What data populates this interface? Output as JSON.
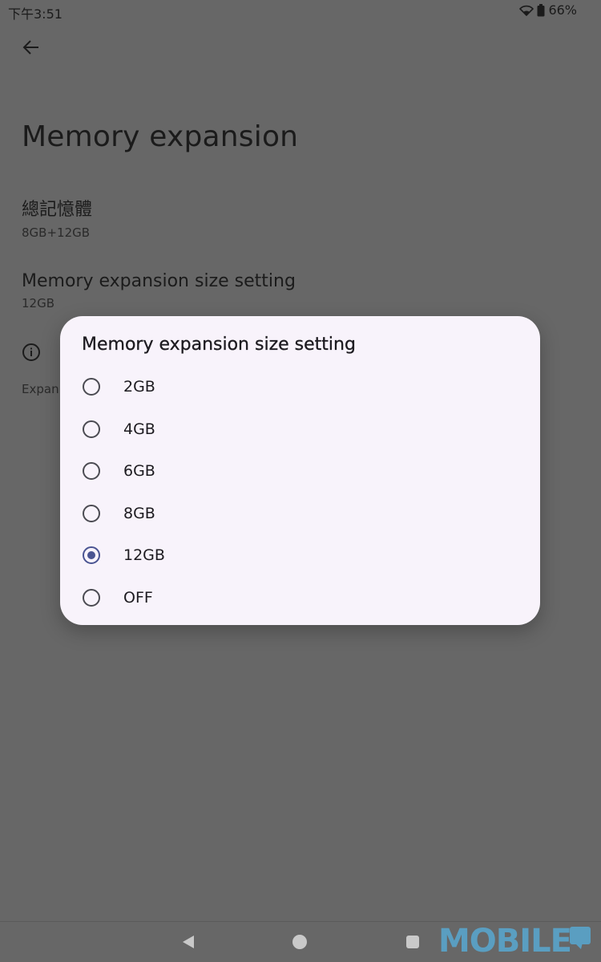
{
  "status_bar": {
    "time": "下午3:51",
    "battery_percent": "66%",
    "icons": [
      "wifi-icon",
      "battery-icon"
    ]
  },
  "header": {
    "back_icon": "arrow-left-icon",
    "title": "Memory expansion"
  },
  "preferences": {
    "total_memory": {
      "title": "總記憶體",
      "value": "8GB+12GB"
    },
    "size_setting": {
      "title": "Memory expansion size setting",
      "value": "12GB"
    }
  },
  "footer": {
    "info_icon": "info-icon",
    "text": "Expan"
  },
  "dialog": {
    "title": "Memory expansion size setting",
    "options": [
      {
        "label": "2GB",
        "selected": false
      },
      {
        "label": "4GB",
        "selected": false
      },
      {
        "label": "6GB",
        "selected": false
      },
      {
        "label": "8GB",
        "selected": false
      },
      {
        "label": "12GB",
        "selected": true
      },
      {
        "label": "OFF",
        "selected": false
      }
    ]
  },
  "nav_bar": {
    "icons": [
      "nav-back-icon",
      "nav-home-icon",
      "nav-recents-icon"
    ]
  },
  "watermark": {
    "text": "MOBILE"
  },
  "colors": {
    "scrim": "#676767",
    "dialog_bg": "#f8f3fb",
    "radio_selected": "#4a5492",
    "watermark": "#5a9ec1"
  }
}
